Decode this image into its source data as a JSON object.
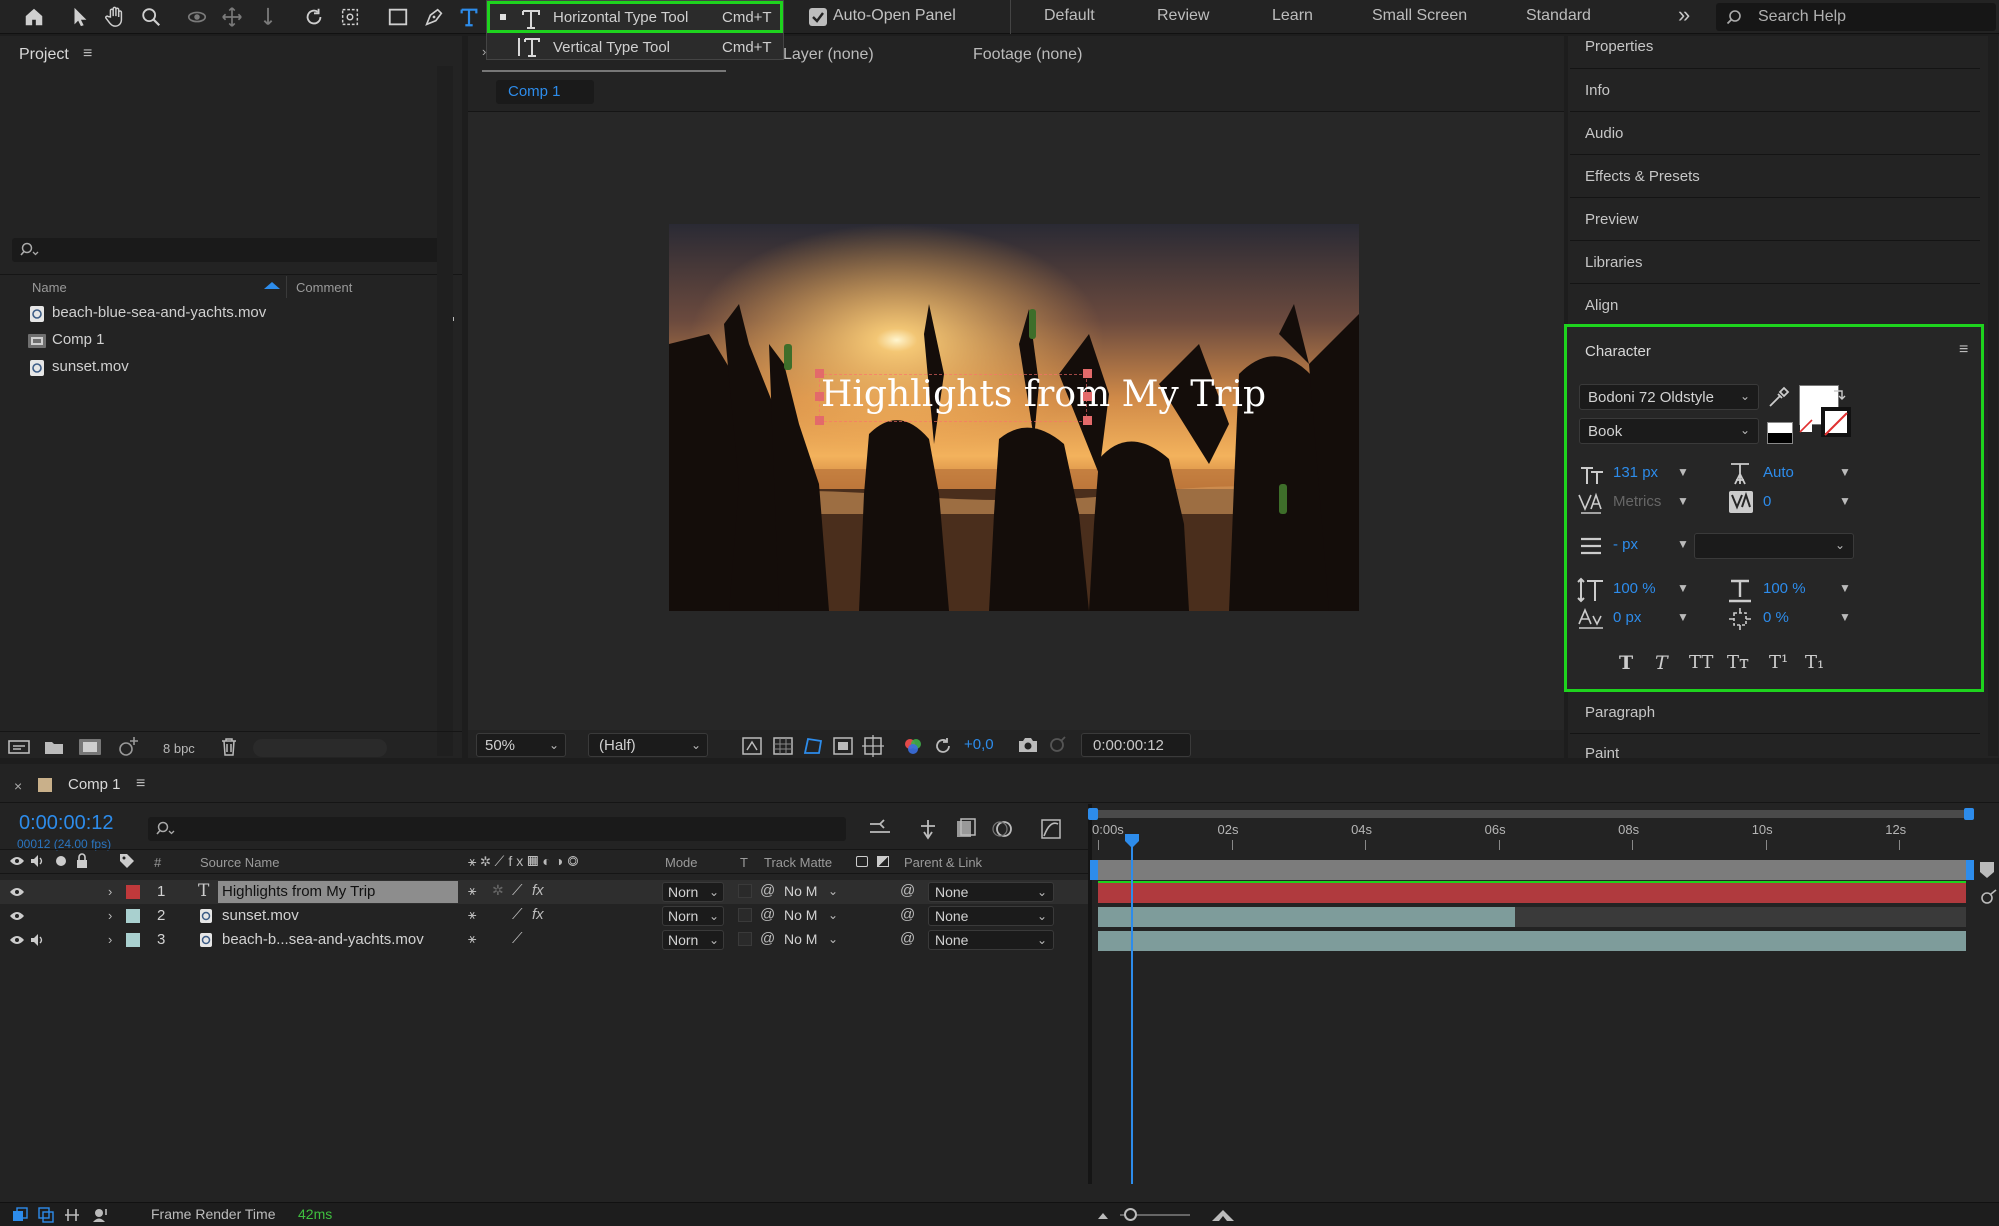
{
  "toolbar": {
    "auto_open_label": "Auto-Open Panel",
    "workspaces": [
      "Default",
      "Review",
      "Learn",
      "Small Screen",
      "Standard"
    ],
    "more_glyph": "»",
    "search_placeholder": "Search Help"
  },
  "type_menu": {
    "items": [
      {
        "label": "Horizontal Type Tool",
        "shortcut": "Cmd+T"
      },
      {
        "label": "Vertical Type Tool",
        "shortcut": "Cmd+T"
      }
    ]
  },
  "project_panel": {
    "title": "Project",
    "columns": {
      "name": "Name",
      "comment": "Comment"
    },
    "items": [
      {
        "name": "beach-blue-sea-and-yachts.mov",
        "icon": "footage-icon"
      },
      {
        "name": "Comp 1",
        "icon": "composition-icon"
      },
      {
        "name": "sunset.mov",
        "icon": "footage-icon"
      }
    ],
    "bpc_label": "8 bpc"
  },
  "viewer": {
    "tabs": [
      "Layer (none)",
      "Footage (none)"
    ],
    "comp_tab": "Comp 1",
    "title_text": "Highlights from My Trip",
    "zoom": "50%",
    "resolution": "(Half)",
    "exposure": "+0,0",
    "timecode": "0:00:00:12"
  },
  "right_panels": {
    "top": [
      "Properties",
      "Info",
      "Audio",
      "Effects & Presets",
      "Preview",
      "Libraries",
      "Align"
    ],
    "bottom": [
      "Paragraph",
      "Paint"
    ]
  },
  "character": {
    "title": "Character",
    "font": "Bodoni 72 Oldstyle",
    "style": "Book",
    "font_size": "131 px",
    "leading": "Auto",
    "kerning": "Metrics",
    "tracking": "0",
    "stroke_width": "- px",
    "vert_scale": "100 %",
    "horiz_scale": "100 %",
    "baseline_shift": "0 px",
    "tsume": "0 %",
    "fill_color": "#ffffff",
    "stroke_color": "#000000",
    "style_buttons": [
      "T",
      "T",
      "TT",
      "Tт",
      "T¹",
      "T₁"
    ]
  },
  "timeline": {
    "comp_tab": "Comp 1",
    "timecode": "0:00:00:12",
    "frame_info": "00012 (24.00 fps)",
    "columns": {
      "source_name": "Source Name",
      "mode": "Mode",
      "t": "T",
      "track_matte": "Track Matte",
      "parent": "Parent & Link",
      "num": "#"
    },
    "ruler": [
      "0:00s",
      "02s",
      "04s",
      "06s",
      "08s",
      "10s",
      "12s"
    ],
    "playhead_seconds": 0.5,
    "duration_seconds": 13,
    "layers": [
      {
        "num": "1",
        "name": "Highlights from My Trip",
        "label_color": "#c0393b",
        "mode": "Norn",
        "matte": "No M",
        "parent": "None",
        "bar_color": "#b03a3e",
        "bar_end_seconds": 13,
        "type": "text"
      },
      {
        "num": "2",
        "name": "sunset.mov",
        "label_color": "#a9d0cf",
        "mode": "Norn",
        "matte": "No M",
        "parent": "None",
        "bar_color": "#7e9c9b",
        "bar_end_seconds": 6.25,
        "type": "footage"
      },
      {
        "num": "3",
        "name": "beach-b...sea-and-yachts.mov",
        "label_color": "#a9d0cf",
        "mode": "Norn",
        "matte": "No M",
        "parent": "None",
        "bar_color": "#7e9c9b",
        "bar_end_seconds": 13,
        "type": "footage"
      }
    ],
    "status_label": "Frame Render Time",
    "status_value": "42ms"
  },
  "colors": {
    "accent": "#2d8ceb",
    "highlight": "#1ed31e"
  }
}
